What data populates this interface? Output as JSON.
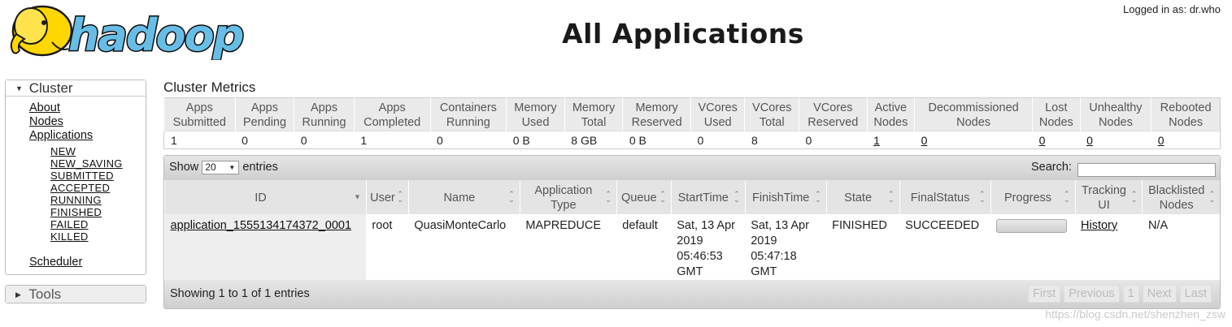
{
  "header": {
    "logo_text": "hadoop",
    "title": "All Applications",
    "logged_in": "Logged in as: dr.who"
  },
  "sidebar": {
    "cluster_label": "Cluster",
    "links": [
      "About",
      "Nodes",
      "Applications"
    ],
    "states": [
      "NEW",
      "NEW_SAVING",
      "SUBMITTED",
      "ACCEPTED",
      "RUNNING",
      "FINISHED",
      "FAILED",
      "KILLED"
    ],
    "scheduler": "Scheduler",
    "tools_label": "Tools",
    "expand_icon": "triangle-down-icon",
    "collapse_icon": "triangle-right-icon"
  },
  "metrics": {
    "title": "Cluster Metrics",
    "headers": [
      [
        "Apps",
        "Submitted"
      ],
      [
        "Apps",
        "Pending"
      ],
      [
        "Apps",
        "Running"
      ],
      [
        "Apps",
        "Completed"
      ],
      [
        "Containers",
        "Running"
      ],
      [
        "Memory",
        "Used"
      ],
      [
        "Memory",
        "Total"
      ],
      [
        "Memory",
        "Reserved"
      ],
      [
        "VCores",
        "Used"
      ],
      [
        "VCores",
        "Total"
      ],
      [
        "VCores",
        "Reserved"
      ],
      [
        "Active",
        "Nodes"
      ],
      [
        "Decommissioned",
        "Nodes"
      ],
      [
        "Lost",
        "Nodes"
      ],
      [
        "Unhealthy",
        "Nodes"
      ],
      [
        "Rebooted",
        "Nodes"
      ]
    ],
    "values": [
      "1",
      "0",
      "0",
      "1",
      "0",
      "0 B",
      "8 GB",
      "0 B",
      "0",
      "8",
      "0",
      "1",
      "0",
      "0",
      "0",
      "0"
    ]
  },
  "table": {
    "show_label": "Show",
    "length_value": "20",
    "entries_label": "entries",
    "search_label": "Search:",
    "search_value": "",
    "headers": [
      [
        "ID"
      ],
      [
        "User"
      ],
      [
        "Name"
      ],
      [
        "Application",
        "Type"
      ],
      [
        "Queue"
      ],
      [
        "StartTime"
      ],
      [
        "FinishTime"
      ],
      [
        "State"
      ],
      [
        "FinalStatus"
      ],
      [
        "Progress"
      ],
      [
        "Tracking",
        "UI"
      ],
      [
        "Blacklisted",
        "Nodes"
      ]
    ],
    "rows": [
      {
        "id": "application_1555134174372_0001",
        "user": "root",
        "name": "QuasiMonteCarlo",
        "type": "MAPREDUCE",
        "queue": "default",
        "start_time": [
          "Sat, 13 Apr",
          "2019",
          "05:46:53",
          "GMT"
        ],
        "finish_time": [
          "Sat, 13 Apr",
          "2019",
          "05:47:18",
          "GMT"
        ],
        "state": "FINISHED",
        "final_status": "SUCCEEDED",
        "progress": 100,
        "tracking_ui": "History",
        "blacklisted": "N/A"
      }
    ],
    "info": "Showing 1 to 1 of 1 entries",
    "pagination": [
      "First",
      "Previous",
      "1",
      "Next",
      "Last"
    ]
  },
  "watermark": "https://blog.csdn.net/shenzhen_zsw",
  "colors": {
    "header_bg": "#eaeaea",
    "bar_bg": "#d8d8d8",
    "text": "#222222",
    "logo_yellow": "#ffd700",
    "logo_blue": "#68bde6"
  }
}
